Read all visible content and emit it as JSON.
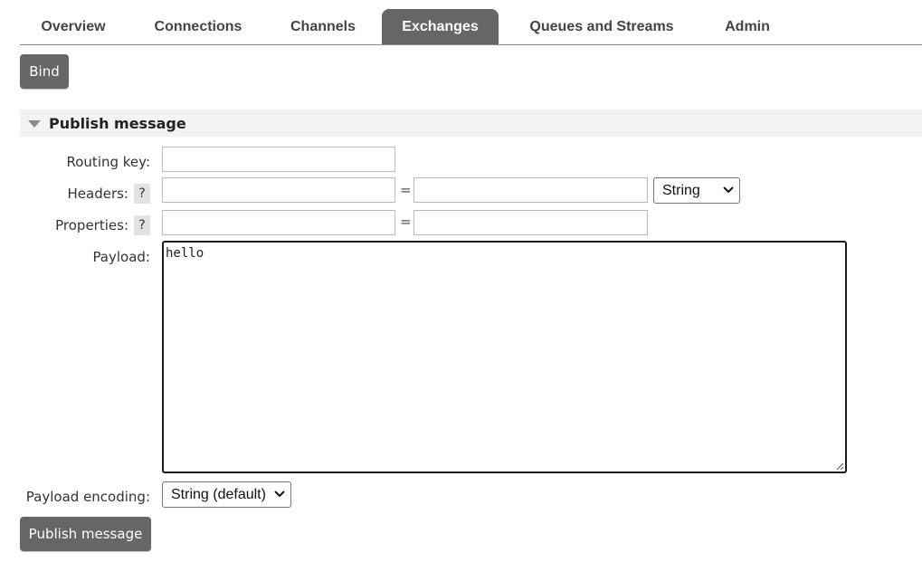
{
  "nav": {
    "tabs": [
      {
        "label": "Overview"
      },
      {
        "label": "Connections"
      },
      {
        "label": "Channels"
      },
      {
        "label": "Exchanges",
        "active": true
      },
      {
        "label": "Queues and Streams"
      },
      {
        "label": "Admin"
      }
    ]
  },
  "bind_button": {
    "label": "Bind"
  },
  "publish_section": {
    "title": "Publish message",
    "routing_key": {
      "label": "Routing key:",
      "value": ""
    },
    "headers": {
      "label": "Headers:",
      "help": "?",
      "key_value": "",
      "equals": "=",
      "value": "",
      "type_selected": "String"
    },
    "properties": {
      "label": "Properties:",
      "help": "?",
      "key_value": "",
      "equals": "=",
      "value": ""
    },
    "payload": {
      "label": "Payload:",
      "value": "hello"
    },
    "payload_encoding": {
      "label": "Payload encoding:",
      "selected": "String (default)"
    },
    "publish_button": {
      "label": "Publish message"
    }
  },
  "colors": {
    "active_tab": "#666666",
    "button": "#666666",
    "section_header_bg": "#f3f3f3"
  }
}
